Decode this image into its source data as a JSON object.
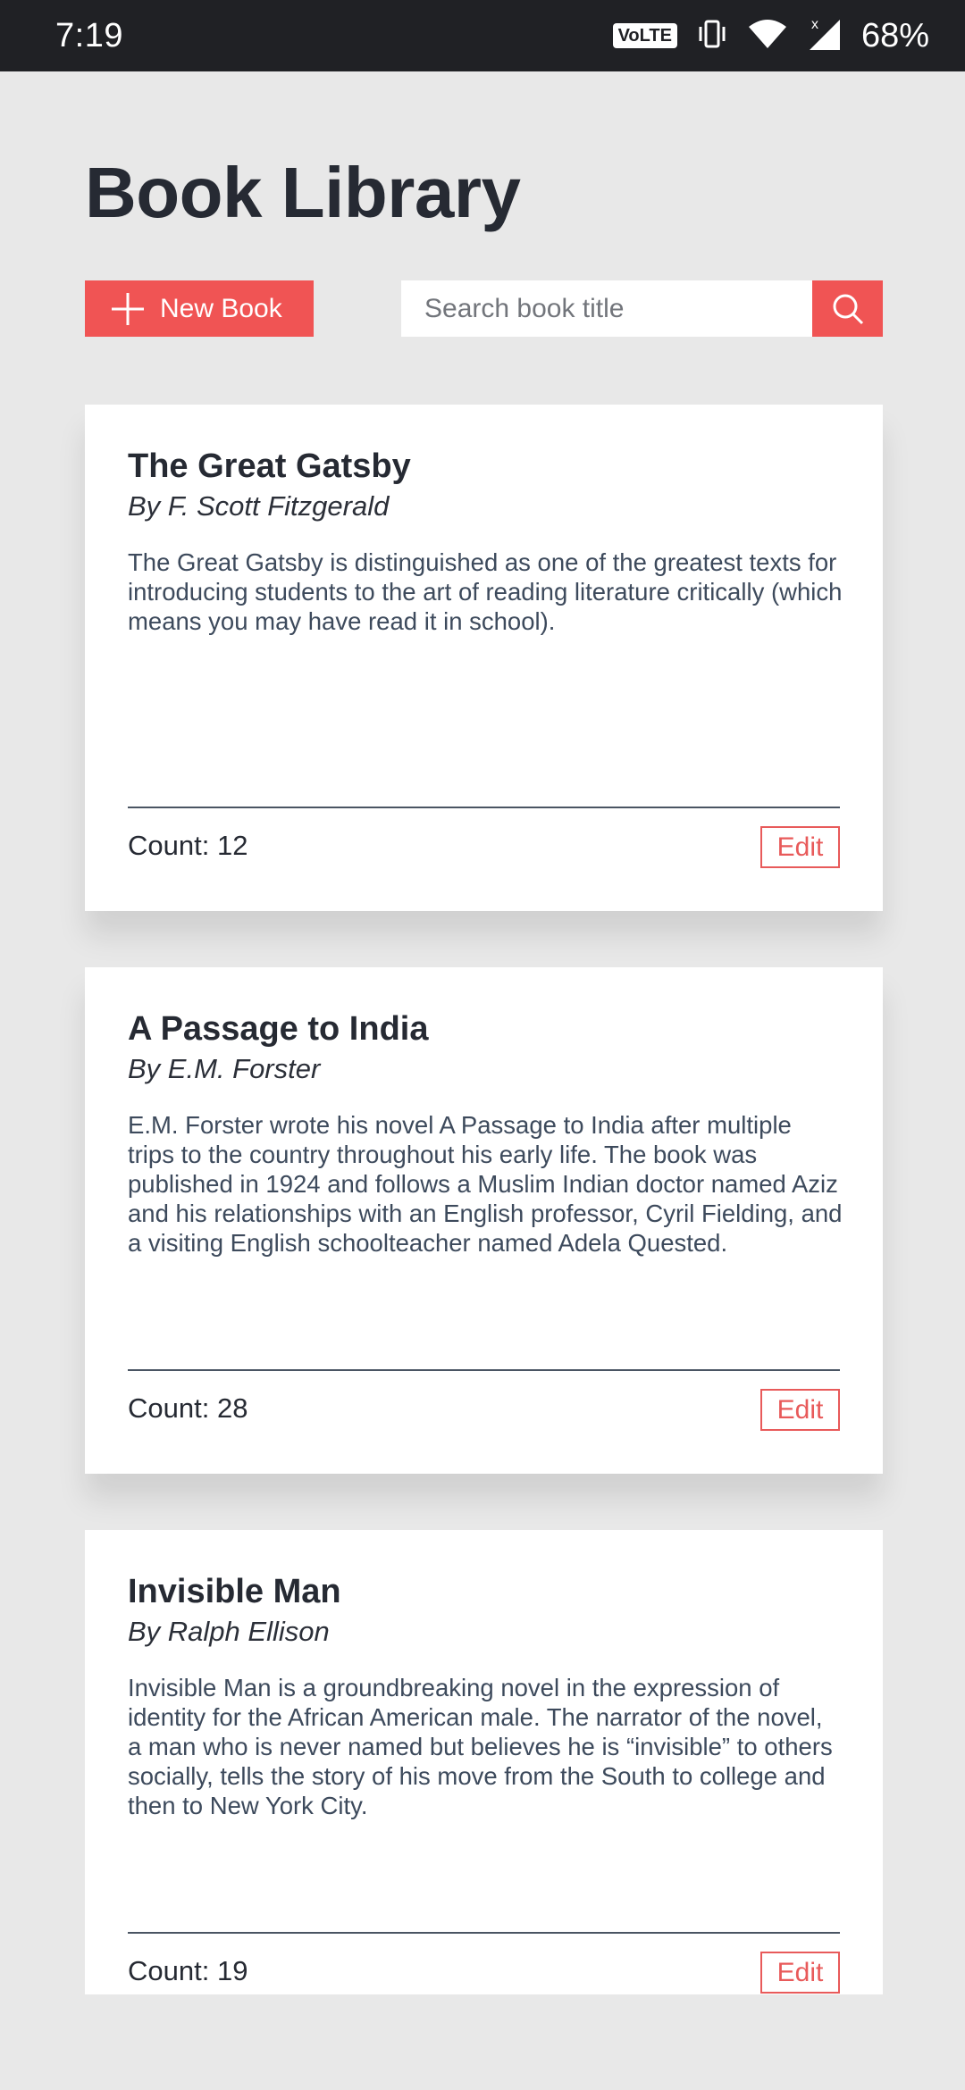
{
  "status_bar": {
    "time": "7:19",
    "volte": "VoLTE",
    "battery": "68%"
  },
  "page": {
    "title": "Book Library"
  },
  "toolbar": {
    "new_book_label": "New Book",
    "search_placeholder": "Search book title"
  },
  "books": [
    {
      "title": "The Great Gatsby",
      "author": "By F. Scott Fitzgerald",
      "description": "The Great Gatsby is distinguished as one of the greatest texts for introducing students to the art of reading literature critically (which means you may have read it in school).",
      "count": "Count: 12",
      "edit_label": "Edit"
    },
    {
      "title": "A Passage to India",
      "author": "By E.M. Forster",
      "description": "E.M. Forster wrote his novel A Passage to India after multiple trips to the country throughout his early life. The book was published in 1924 and follows a Muslim Indian doctor named Aziz and his relationships with an English professor, Cyril Fielding, and a visiting English schoolteacher named Adela Quested.",
      "count": "Count: 28",
      "edit_label": "Edit"
    },
    {
      "title": "Invisible Man",
      "author": "By Ralph Ellison",
      "description": "Invisible Man is a groundbreaking novel in the expression of identity for the African American male. The narrator of the novel, a man who is never named but believes he is “invisible” to others socially, tells the story of his move from the South to college and then to New York City.",
      "count": "Count: 19",
      "edit_label": "Edit"
    }
  ]
}
